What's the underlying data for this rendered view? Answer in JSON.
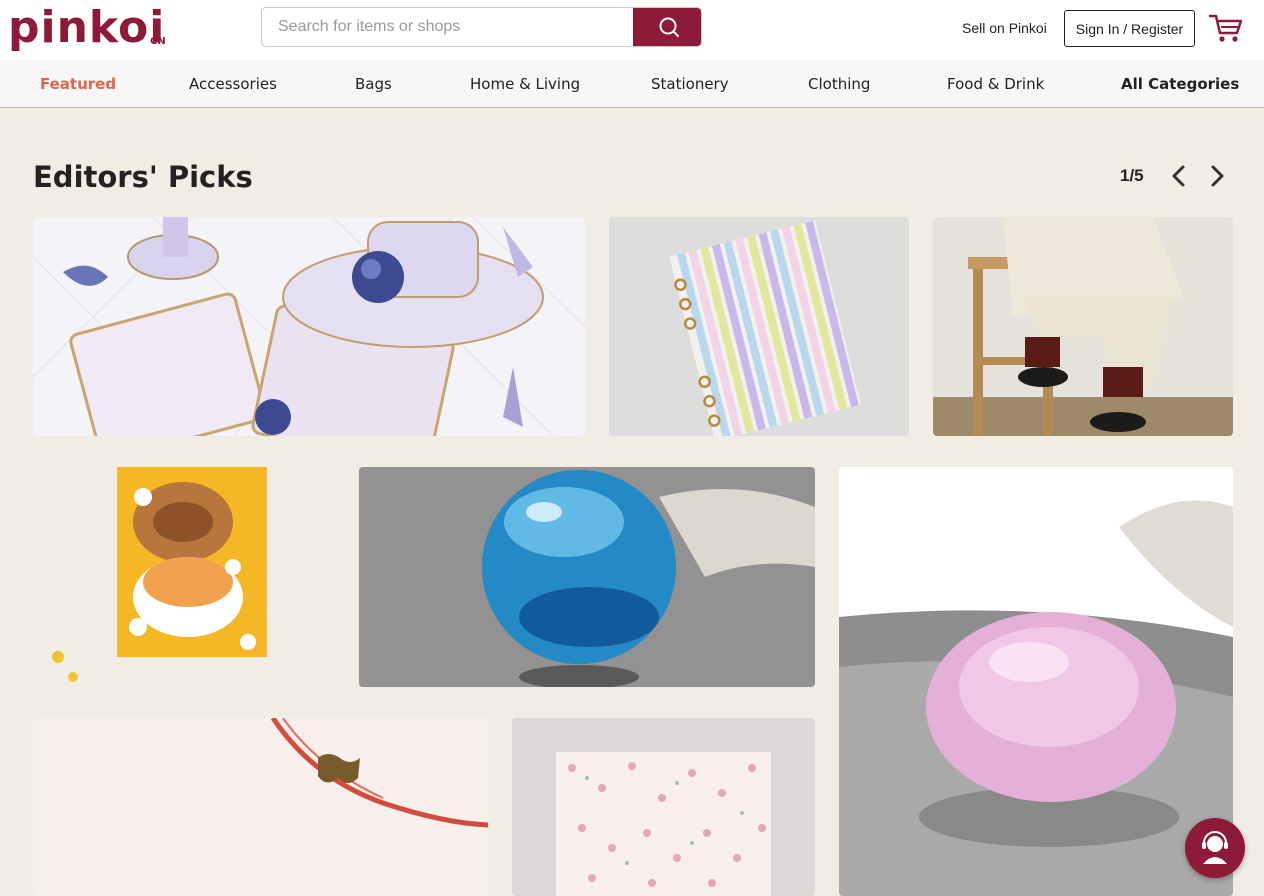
{
  "brand": {
    "logo_text": "pinkoi",
    "region": "CN",
    "accent": "#8c1a38"
  },
  "search": {
    "placeholder": "Search for items or shops"
  },
  "header": {
    "sell_label": "Sell on Pinkoi",
    "signin_label": "Sign In / Register"
  },
  "nav": {
    "items": [
      {
        "label": "Featured"
      },
      {
        "label": "Accessories"
      },
      {
        "label": "Bags"
      },
      {
        "label": "Home & Living"
      },
      {
        "label": "Stationery"
      },
      {
        "label": "Clothing"
      },
      {
        "label": "Food & Drink"
      },
      {
        "label": "All Categories"
      }
    ],
    "active_color": "#e3634b"
  },
  "editors_picks": {
    "title": "Editors' Picks",
    "pager": "1/5"
  },
  "icons": {
    "search": "search-icon",
    "cart": "cart-icon",
    "prev": "chevron-left-icon",
    "next": "chevron-right-icon",
    "chat": "customer-service-icon"
  }
}
